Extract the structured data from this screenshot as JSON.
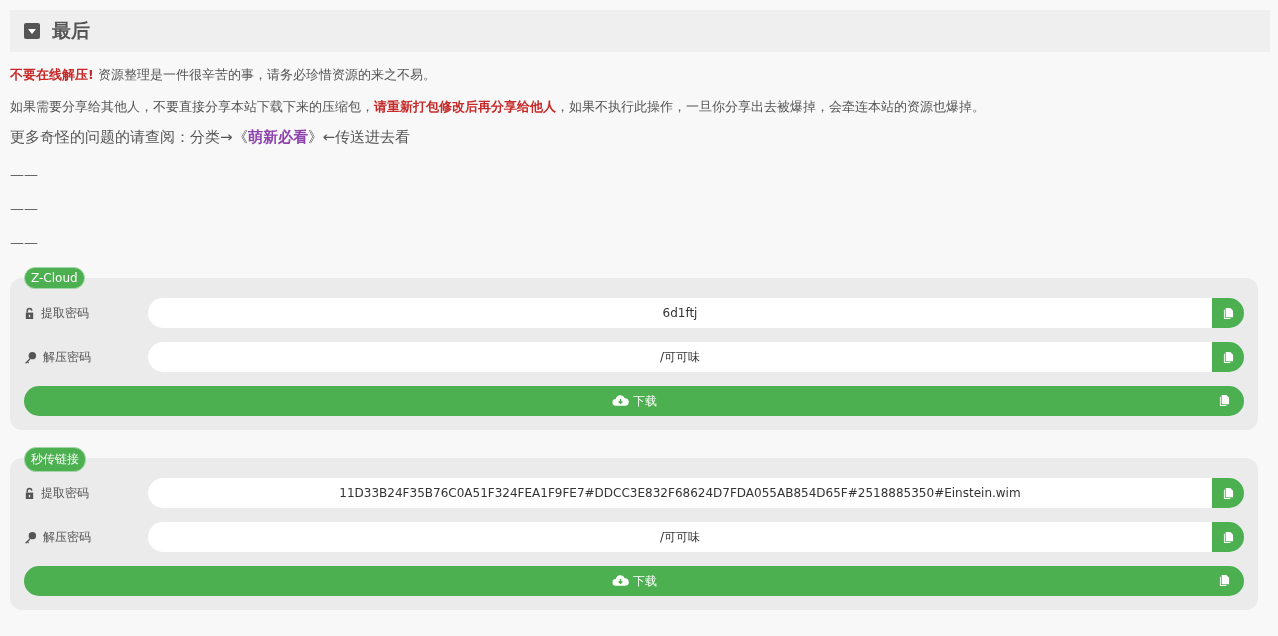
{
  "section": {
    "title": "最后",
    "expanded": true
  },
  "paragraphs": [
    {
      "kind": "text",
      "text": "**不要在线解压!** 资源整理是一件很辛苦的事，请务必珍惜资源的来之不易。"
    },
    {
      "kind": "text",
      "text": "如果需要分享给其他人，不要直接分享本站下载下来的压缩包，**请重新打包修改后再分享给他人**，如果不执行此操作，一旦你分享出去被爆掉，会牵连本站的资源也爆掉。"
    },
    {
      "kind": "link",
      "before": "更多奇怪的问题的请查阅：分类→《",
      "link": "萌新必看",
      "after": "》←传送进去看"
    },
    {
      "kind": "rule",
      "text": "——"
    },
    {
      "kind": "rule",
      "text": "——"
    },
    {
      "kind": "rule",
      "text": "——"
    }
  ],
  "downloads": [
    {
      "badge": "Z-Cloud",
      "fields": [
        {
          "kind": "lock",
          "label": "提取密码",
          "value": "6d1ftj"
        },
        {
          "kind": "key",
          "label": "解压密码",
          "value": "/可可味"
        }
      ],
      "button": "下载"
    },
    {
      "badge": "秒传链接",
      "fields": [
        {
          "kind": "lock",
          "label": "提取密码",
          "value": "11D33B24F35B76C0A51F324FEA1F9FE7#DDCC3E832F68624D7FDA055AB854D65F#2518885350#Einstein.wim"
        },
        {
          "kind": "key",
          "label": "解压密码",
          "value": "/可可味"
        }
      ],
      "button": "下载"
    }
  ]
}
